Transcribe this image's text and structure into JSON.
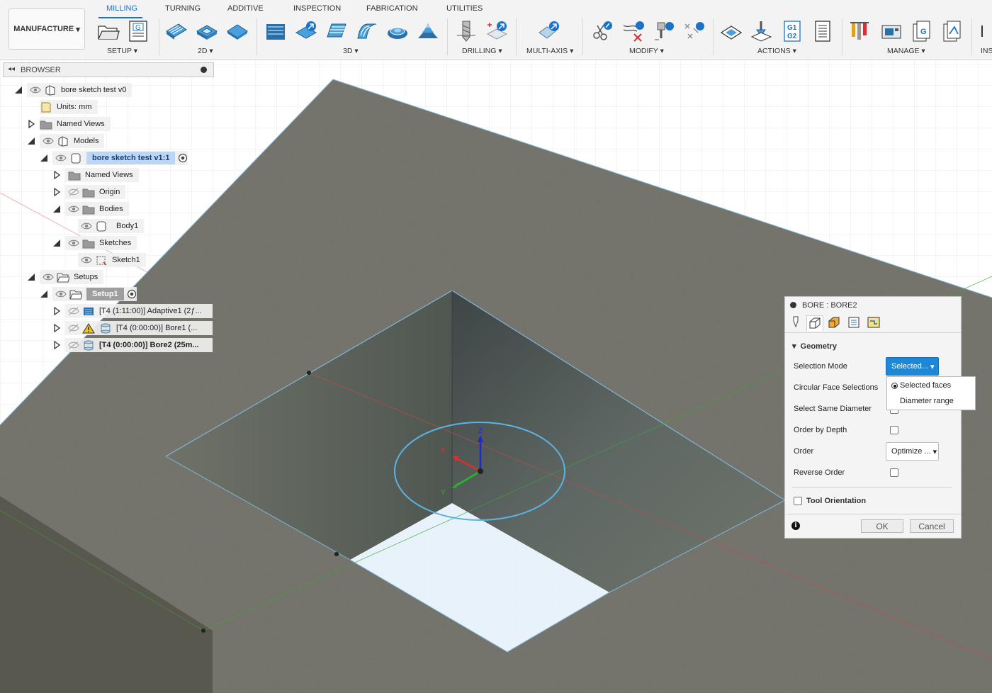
{
  "workspace": {
    "label": "MANUFACTURE"
  },
  "tabs": [
    "MILLING",
    "TURNING",
    "ADDITIVE",
    "INSPECTION",
    "FABRICATION",
    "UTILITIES"
  ],
  "groups": {
    "setup": "SETUP",
    "g2d": "2D",
    "g3d": "3D",
    "drilling": "DRILLING",
    "multiaxis": "MULTI-AXIS",
    "modify": "MODIFY",
    "actions": "ACTIONS",
    "manage": "MANAGE",
    "ins": "INS"
  },
  "icons": {
    "g_code": "G",
    "g1g2_top": "G1",
    "g1g2_bottom": "G2"
  },
  "browser": {
    "title": "BROWSER",
    "items": {
      "root": "bore sketch test v0",
      "units": "Units: mm",
      "named_views": "Named Views",
      "models": "Models",
      "model": "bore sketch test v1:1",
      "model_named_views": "Named Views",
      "origin": "Origin",
      "bodies": "Bodies",
      "body1": "Body1",
      "sketches": "Sketches",
      "sketch1": "Sketch1",
      "setups": "Setups",
      "setup1": "Setup1",
      "op_adaptive": "[T4 (1:11:00)] Adaptive1 (2ƒ...",
      "op_bore1": "[T4 (0:00:00)] Bore1 (...",
      "op_bore2": "[T4 (0:00:00)] Bore2 (25m..."
    }
  },
  "triad": {
    "x": "X",
    "y": "Y",
    "z": "Z"
  },
  "dialog": {
    "title": "BORE : BORE2",
    "section": "Geometry",
    "fields": {
      "selection_mode": "Selection Mode",
      "circular_face": "Circular Face Selections",
      "same_diameter": "Select Same Diameter",
      "order_by_depth": "Order by Depth",
      "order": "Order",
      "reverse_order": "Reverse Order"
    },
    "selection_mode_value": "Selected...",
    "order_value": "Optimize ...",
    "dropdown_options": [
      "Selected faces",
      "Diameter range"
    ],
    "tool_orientation": "Tool Orientation",
    "ok": "OK",
    "cancel": "Cancel"
  },
  "colors": {
    "accent": "#1a73c8",
    "surface": "#74746d",
    "selection_ring": "#5ab3e0",
    "highlight": "#bcd7f3"
  }
}
